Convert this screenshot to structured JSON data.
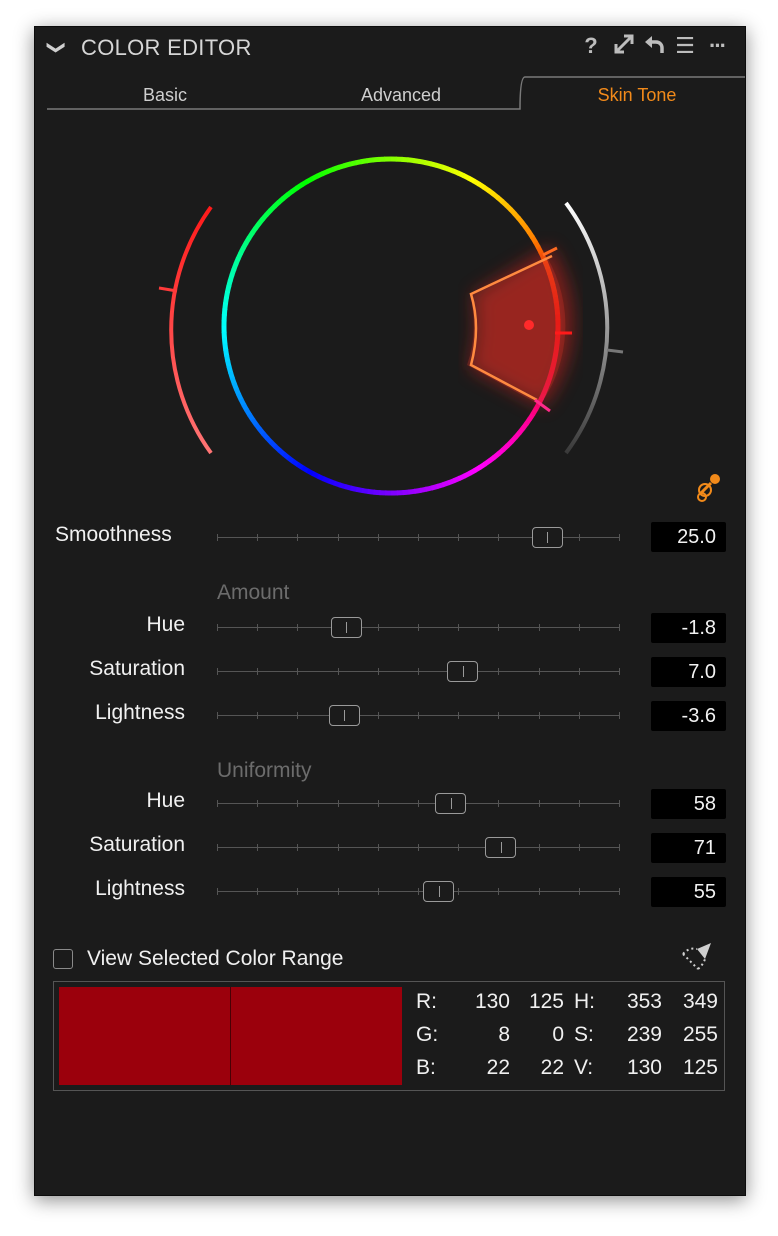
{
  "header": {
    "title": "COLOR EDITOR",
    "icons": [
      "chevron-down-icon",
      "help-icon",
      "expand-icon",
      "reset-icon",
      "menu-icon",
      "more-icon"
    ],
    "help_glyph": "?",
    "menu_glyph": "☰",
    "more_glyph": "···",
    "chevron_glyph": "❯"
  },
  "tabs": [
    {
      "label": "Basic",
      "active": false
    },
    {
      "label": "Advanced",
      "active": false
    },
    {
      "label": "Skin Tone",
      "active": true
    }
  ],
  "accent_color": "#f28a1a",
  "smoothness": {
    "label": "Smoothness",
    "value": "25.0",
    "fraction": 0.82
  },
  "amount": {
    "label": "Amount",
    "hue": {
      "label": "Hue",
      "value": "-1.8",
      "fraction": 0.32
    },
    "saturation": {
      "label": "Saturation",
      "value": "7.0",
      "fraction": 0.61
    },
    "lightness": {
      "label": "Lightness",
      "value": "-3.6",
      "fraction": 0.315
    }
  },
  "uniformity": {
    "label": "Uniformity",
    "hue": {
      "label": "Hue",
      "value": "58",
      "fraction": 0.58
    },
    "saturation": {
      "label": "Saturation",
      "value": "71",
      "fraction": 0.705
    },
    "lightness": {
      "label": "Lightness",
      "value": "55",
      "fraction": 0.55
    }
  },
  "view_range": {
    "label": "View Selected Color Range",
    "checked": false
  },
  "swatch_color": "#9b000c",
  "color_info": {
    "rows": [
      {
        "l1": "R:",
        "a": "130",
        "b": "125",
        "l2": "H:",
        "c": "353",
        "d": "349"
      },
      {
        "l1": "G:",
        "a": "8",
        "b": "0",
        "l2": "S:",
        "c": "239",
        "d": "255"
      },
      {
        "l1": "B:",
        "a": "22",
        "b": "22",
        "l2": "V:",
        "c": "130",
        "d": "125"
      }
    ]
  }
}
